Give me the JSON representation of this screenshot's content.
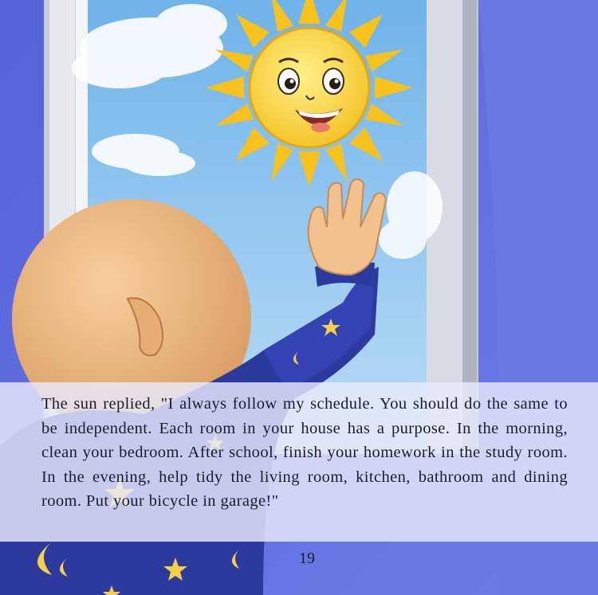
{
  "story": {
    "text": "The sun replied, \"I always follow my schedule. You should do the same to be independent. Each room in your house has a purpose. In the morning, clean your bedroom. After school, finish your homework in the study room. In the evening, help tidy the living room, kitchen, bathroom and dining room. Put your bicycle in garage!\"",
    "page_number": "19"
  },
  "colors": {
    "wall": "#5f6fe0",
    "sky": "#8ec6f0",
    "sun": "#f5c92a",
    "pajamas": "#2c3a9e",
    "skin": "#f2c28e"
  }
}
